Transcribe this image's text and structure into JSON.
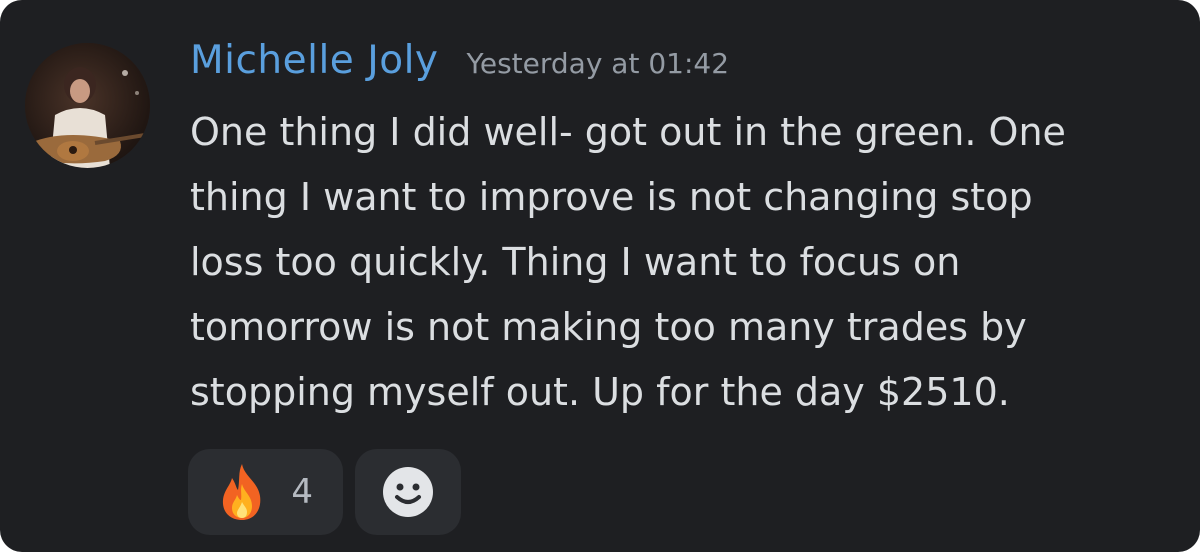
{
  "message": {
    "author": "Michelle Joly",
    "timestamp": "Yesterday at 01:42",
    "lines": [
      "One thing I did well- got out in the green. One",
      "thing I want to improve is not changing stop",
      "loss too quickly. Thing I want to focus on",
      "tomorrow is not making too many trades by",
      "stopping myself out. Up for the day $2510."
    ]
  },
  "reactions": [
    {
      "emoji": "fire-icon",
      "count": "4"
    },
    {
      "emoji": "add-reaction-smile-icon"
    }
  ],
  "colors": {
    "background": "#1e1f22",
    "username": "#5a9fde",
    "timestamp": "#949ba4",
    "text": "#dbdee1",
    "reaction_bg": "#2b2d31"
  }
}
